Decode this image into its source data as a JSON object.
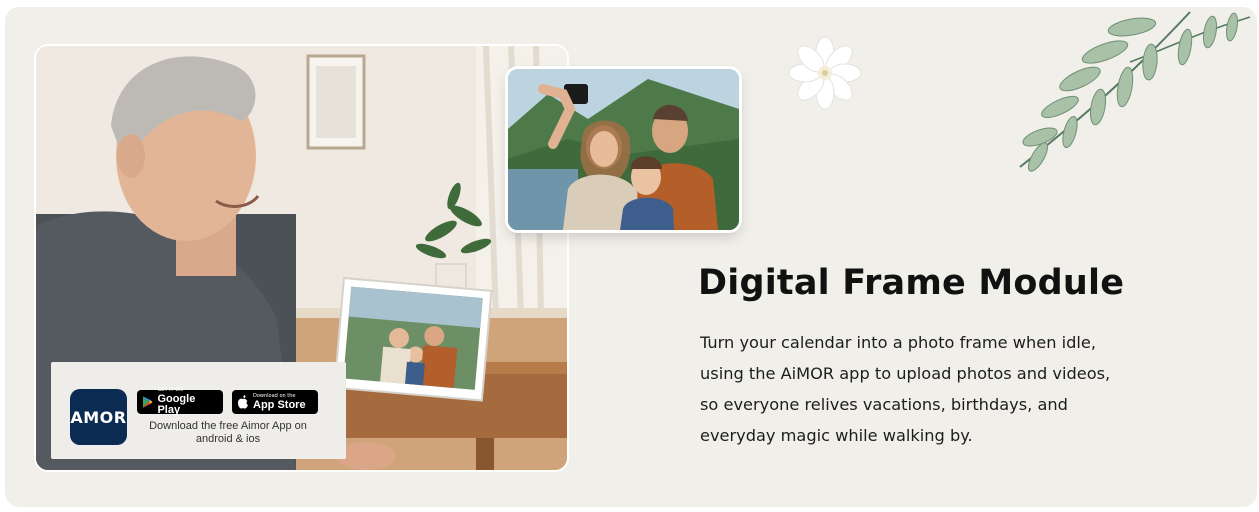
{
  "section": {
    "title": "Digital Frame Module",
    "description_lines": [
      "Turn your calendar into a photo frame when idle,",
      "using the AiMOR app to upload photos and videos,",
      "so everyone relives vacations, birthdays, and",
      "everyday magic while walking by."
    ]
  },
  "app_promo": {
    "logo_text": "AMOR",
    "google_play": {
      "small": "GET IT ON",
      "big": "Google Play"
    },
    "app_store": {
      "small": "Download on the",
      "big": "App Store"
    },
    "caption_line1": "Download the free Aimor App on",
    "caption_line2": "android & ios"
  },
  "icons": {
    "google_play_icon": "google-play-triangle",
    "apple_icon": "apple-logo",
    "flower_icon": "white-flower",
    "leaves_icon": "green-leaf-branch"
  },
  "colors": {
    "background": "#f1efea",
    "app_logo": "#0c2b52",
    "store_badge": "#000000",
    "heading": "#111111"
  }
}
